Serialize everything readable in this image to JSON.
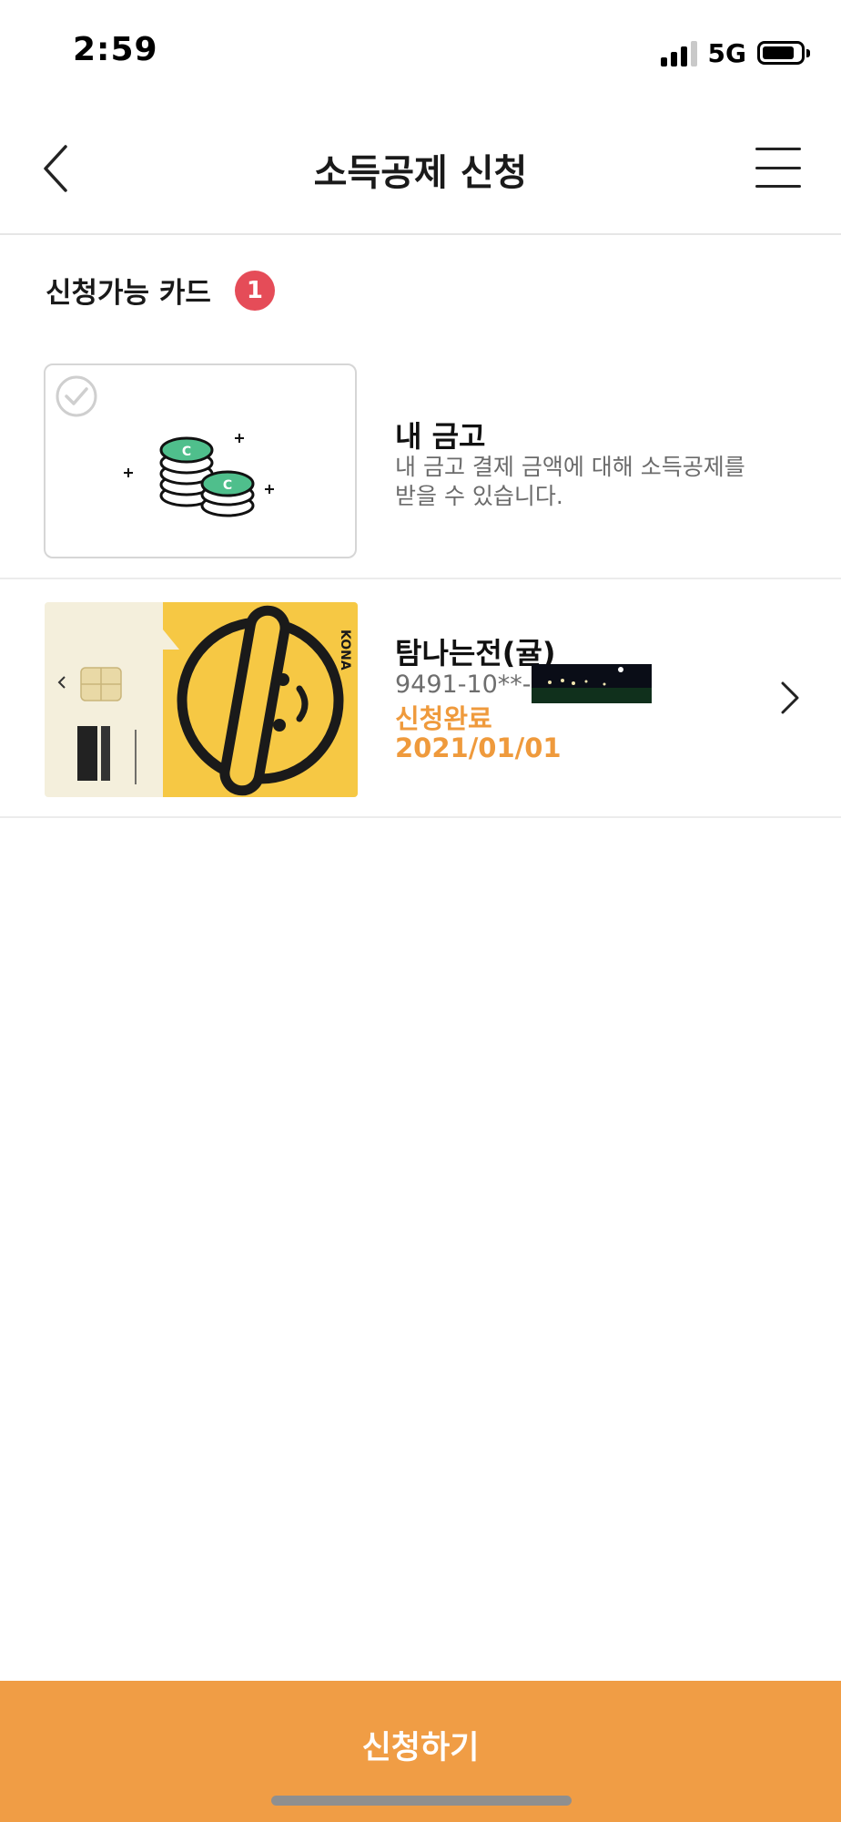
{
  "status_bar": {
    "time": "2:59",
    "network": "5G",
    "signal_bars": 3,
    "battery_level": 0.85
  },
  "header": {
    "title": "소득공제 신청"
  },
  "section": {
    "title": "신청가능 카드",
    "badge_count": "1"
  },
  "vault": {
    "title": "내 금고",
    "description_line1": "내 금고 결제 금액에 대해 소득공제를",
    "description_line2": "받을 수 있습니다."
  },
  "card": {
    "name": "탐나는전(귤)",
    "number": "9491-10**-*",
    "status": "신청완료",
    "date": "2021/01/01",
    "brand_mark": "KONA"
  },
  "footer": {
    "apply_label": "신청하기"
  },
  "colors": {
    "accent": "#f09d45",
    "badge": "#e54c58",
    "card_yellow": "#f6c844",
    "card_cream": "#f4efdc"
  }
}
